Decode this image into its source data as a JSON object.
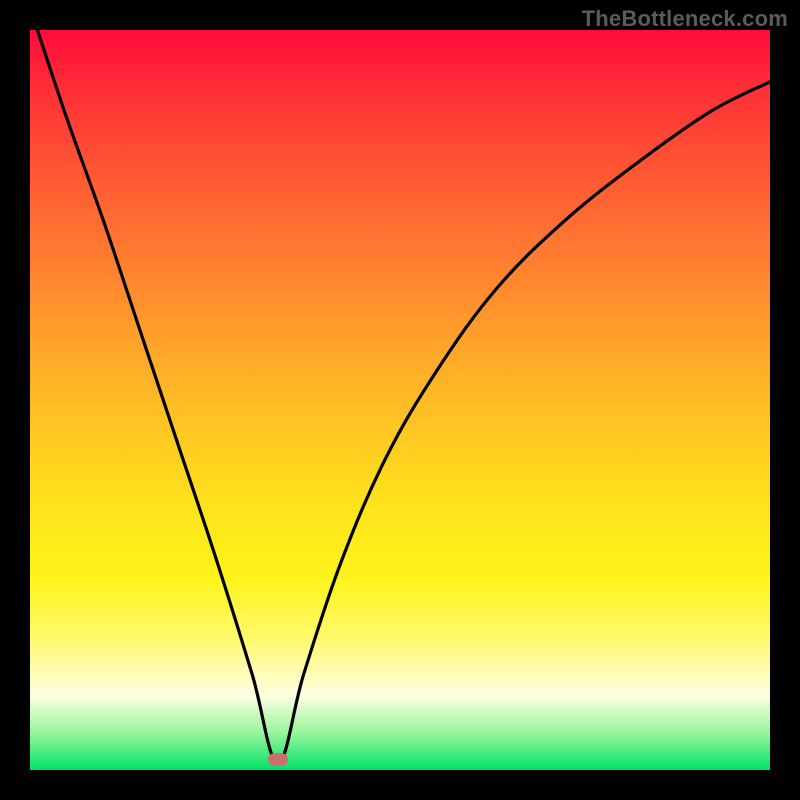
{
  "watermark": {
    "label": "TheBottleneck.com"
  },
  "chart_data": {
    "type": "line",
    "title": "",
    "xlabel": "",
    "ylabel": "",
    "xlim": [
      0,
      100
    ],
    "ylim": [
      0,
      100
    ],
    "grid": false,
    "legend": false,
    "annotations": [
      {
        "kind": "marker",
        "x": 33.5,
        "y": 1.5,
        "shape": "pill",
        "color": "#cc6e6e"
      }
    ],
    "background": {
      "gradient": "vertical",
      "stops": [
        {
          "pos": 0,
          "color": "#ff0b3a"
        },
        {
          "pos": 50,
          "color": "#ffc622"
        },
        {
          "pos": 80,
          "color": "#fff31a"
        },
        {
          "pos": 95,
          "color": "#97f59a"
        },
        {
          "pos": 100,
          "color": "#00e36a"
        }
      ]
    },
    "series": [
      {
        "name": "bottleneck-curve",
        "x": [
          1,
          5,
          10,
          15,
          20,
          25,
          30,
          33.5,
          37,
          42,
          48,
          55,
          63,
          72,
          82,
          92,
          100
        ],
        "values": [
          100,
          88,
          74,
          59,
          44,
          29,
          13,
          1,
          13,
          28,
          42,
          54,
          65,
          74,
          82,
          89,
          93
        ]
      }
    ]
  }
}
